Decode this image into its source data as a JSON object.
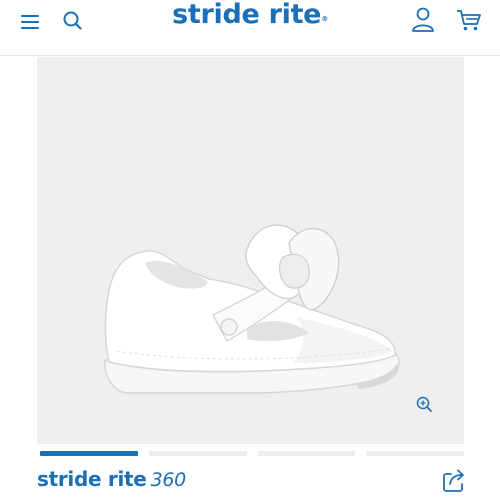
{
  "header": {
    "logo_text": "stride rite",
    "logo_mark": "®",
    "menu_icon": "hamburger-menu-icon",
    "search_icon": "search-icon",
    "account_icon": "user-account-icon",
    "cart_icon": "shopping-cart-icon"
  },
  "gallery": {
    "product_image": "white toddler shoe with bow",
    "zoom_icon": "zoom-in-icon",
    "slides_total": 4,
    "active_slide": 1
  },
  "footer": {
    "brand_text": "stride rite",
    "brand_360": "360",
    "share_icon": "share-icon"
  },
  "colors": {
    "accent": "#1b6fb8",
    "gallery_bg": "#efefef",
    "inactive_dot": "#eeeeee"
  }
}
